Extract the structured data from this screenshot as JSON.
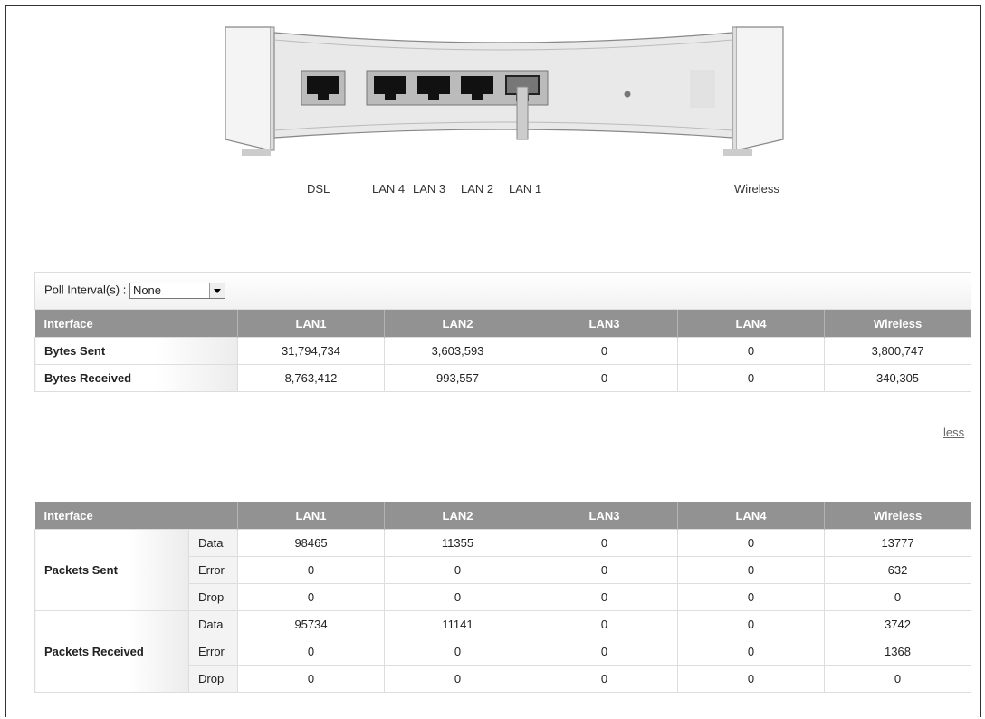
{
  "ports": {
    "dsl": "DSL",
    "lan4": "LAN 4",
    "lan3": "LAN 3",
    "lan2": "LAN 2",
    "lan1": "LAN 1",
    "wireless": "Wireless"
  },
  "poll": {
    "label": "Poll Interval(s) :",
    "value": "None"
  },
  "bytes_table": {
    "headers": [
      "Interface",
      "LAN1",
      "LAN2",
      "LAN3",
      "LAN4",
      "Wireless"
    ],
    "rows": [
      {
        "label": "Bytes Sent",
        "values": [
          "31,794,734",
          "3,603,593",
          "0",
          "0",
          "3,800,747"
        ]
      },
      {
        "label": "Bytes Received",
        "values": [
          "8,763,412",
          "993,557",
          "0",
          "0",
          "340,305"
        ]
      }
    ]
  },
  "less_link": "less",
  "packets_table": {
    "headers": [
      "Interface",
      "LAN1",
      "LAN2",
      "LAN3",
      "LAN4",
      "Wireless"
    ],
    "groups": [
      {
        "label": "Packets Sent",
        "rows": [
          {
            "type": "Data",
            "values": [
              "98465",
              "11355",
              "0",
              "0",
              "13777"
            ]
          },
          {
            "type": "Error",
            "values": [
              "0",
              "0",
              "0",
              "0",
              "632"
            ]
          },
          {
            "type": "Drop",
            "values": [
              "0",
              "0",
              "0",
              "0",
              "0"
            ]
          }
        ]
      },
      {
        "label": "Packets Received",
        "rows": [
          {
            "type": "Data",
            "values": [
              "95734",
              "11141",
              "0",
              "0",
              "3742"
            ]
          },
          {
            "type": "Error",
            "values": [
              "0",
              "0",
              "0",
              "0",
              "1368"
            ]
          },
          {
            "type": "Drop",
            "values": [
              "0",
              "0",
              "0",
              "0",
              "0"
            ]
          }
        ]
      }
    ]
  }
}
